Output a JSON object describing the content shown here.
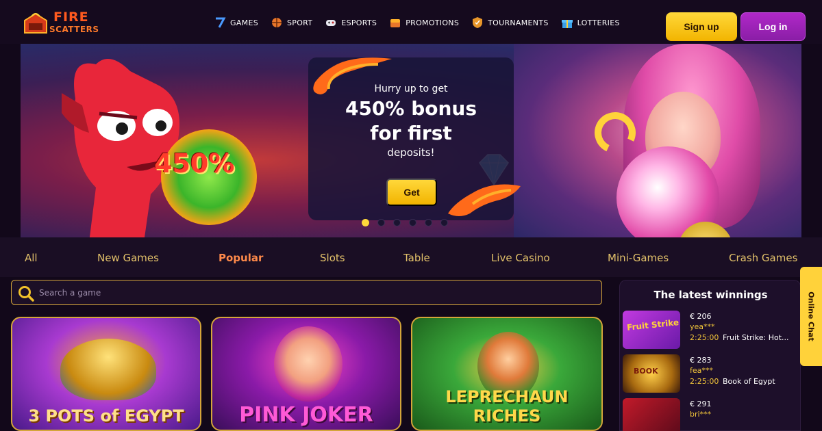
{
  "header": {
    "logo_line1": "FIRE",
    "logo_line2": "SCATTERS",
    "nav": [
      {
        "label": "GAMES",
        "icon": "seven-icon"
      },
      {
        "label": "SPORT",
        "icon": "ball-icon"
      },
      {
        "label": "ESPORTS",
        "icon": "gamepad-icon"
      },
      {
        "label": "PROMOTIONS",
        "icon": "chest-icon"
      },
      {
        "label": "TOURNAMENTS",
        "icon": "shield-icon"
      },
      {
        "label": "LOTTERIES",
        "icon": "gift-icon"
      }
    ],
    "signup_label": "Sign up",
    "login_label": "Log in"
  },
  "hero": {
    "badge_text": "450%",
    "promo_line1": "Hurry up to get",
    "promo_line2": "450% bonus",
    "promo_line3": "for first",
    "promo_line4": "deposits!",
    "cta_label": "Get",
    "slides_total": 6,
    "slide_active": 1
  },
  "tabs": [
    {
      "label": "All",
      "active": false
    },
    {
      "label": "New Games",
      "active": false
    },
    {
      "label": "Popular",
      "active": true
    },
    {
      "label": "Slots",
      "active": false
    },
    {
      "label": "Table",
      "active": false
    },
    {
      "label": "Live Casino",
      "active": false
    },
    {
      "label": "Mini-Games",
      "active": false
    },
    {
      "label": "Crash Games",
      "active": false
    }
  ],
  "search": {
    "placeholder": "Search a game"
  },
  "games": [
    {
      "title": "3 POTS of EGYPT"
    },
    {
      "title": "PINK JOKER"
    },
    {
      "title": "LEPRECHAUN RICHES"
    }
  ],
  "winnings": {
    "title": "The latest winnings",
    "items": [
      {
        "amount": "€ 206",
        "user": "yea***",
        "time": "2:25:00",
        "game": "Fruit Strike: Hot..."
      },
      {
        "amount": "€ 283",
        "user": "fea***",
        "time": "2:25:00",
        "game": "Book of Egypt"
      },
      {
        "amount": "€ 291",
        "user": "bri***",
        "time": "",
        "game": ""
      }
    ]
  },
  "online_chat": "Online Chat",
  "colors": {
    "accent_yellow": "#ffd23a",
    "accent_purple": "#a024bc",
    "active_tab": "#ff8a4a",
    "tab_text": "#e2c16a",
    "background": "#12081a"
  }
}
